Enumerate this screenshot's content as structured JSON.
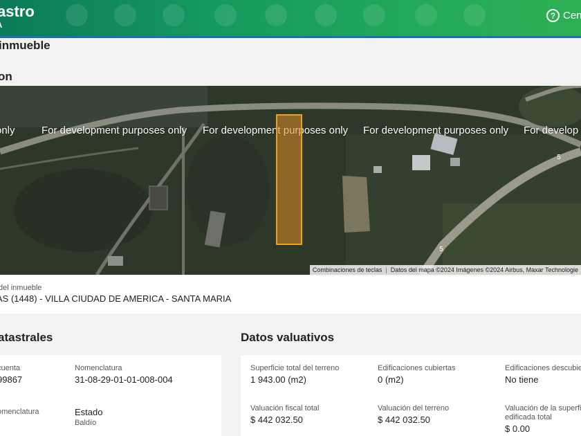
{
  "header": {
    "brand": "astro",
    "brand_sub": "A",
    "help_label": "Cen",
    "colors": {
      "gradient_start": "#0b7a58",
      "gradient_end": "#2db053",
      "accent_line": "#1c6fb7"
    }
  },
  "page_title": "inmueble",
  "section_title": "on",
  "map": {
    "watermarks": [
      "only",
      "For development purposes only",
      "For development purposes only",
      "For development purposes only",
      "For develop"
    ],
    "attribution": {
      "shortcuts": "Combinaciones de teclas",
      "data": "Datos del mapa ©2024 Imágenes ©2024 Airbus, Maxar Technologie"
    },
    "road_markers": [
      "5",
      "5"
    ],
    "parcel_color": "#f0a020"
  },
  "address": {
    "label": "del inmueble",
    "value": "AS (1448) - VILLA CIUDAD DE AMERICA - SANTA MARIA"
  },
  "catastrales": {
    "title": "atastrales",
    "fields": [
      {
        "label": "cuenta",
        "value": "99867"
      },
      {
        "label": "Nomenclatura",
        "value": "31-08-29-01-01-008-004"
      },
      {
        "label": "omenclatura",
        "value": ""
      },
      {
        "label": "Estado",
        "value": "Baldío"
      }
    ]
  },
  "valuativos": {
    "title": "Datos valuativos",
    "fields": [
      {
        "label": "Superficie total del terreno",
        "value": "1 943.00 (m2)"
      },
      {
        "label": "Edificaciones cubiertas",
        "value": "0 (m2)"
      },
      {
        "label": "Edificaciones descubie",
        "value": "No tiene"
      },
      {
        "label": "Valuación fiscal total",
        "value": "$ 442 032.50"
      },
      {
        "label": "Valuación del terreno",
        "value": "$ 442 032.50"
      },
      {
        "label": "Valuación de la superfic",
        "label2": "edificada total",
        "value": "$ 0.00"
      }
    ]
  }
}
